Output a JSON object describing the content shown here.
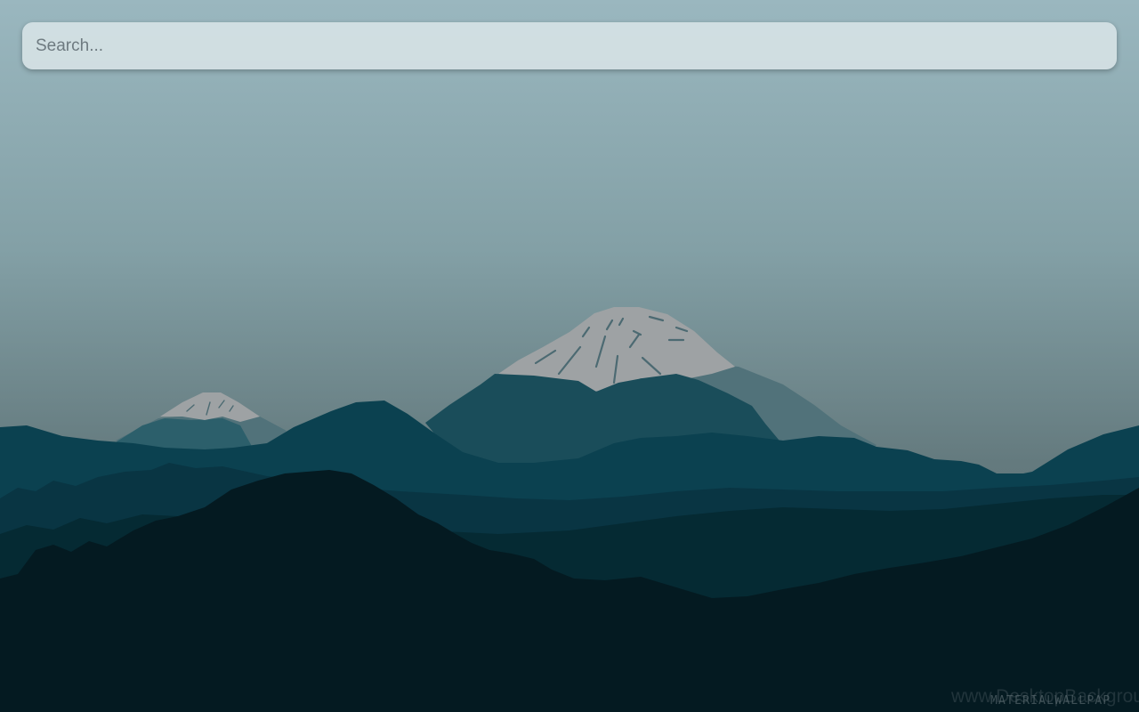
{
  "search": {
    "placeholder": "Search...",
    "value": ""
  },
  "wallpaper": {
    "subject": "mountain landscape",
    "sky_top_color": "#9ab7bf",
    "sky_bottom_color": "#5a6c70",
    "snow_color": "#9ea2a4",
    "ridge_color": "#0b4150",
    "forest_color": "#041a21"
  },
  "watermarks": {
    "site": "www.DesktopBackgrou",
    "brand": "MATERIALWALLPAP"
  }
}
